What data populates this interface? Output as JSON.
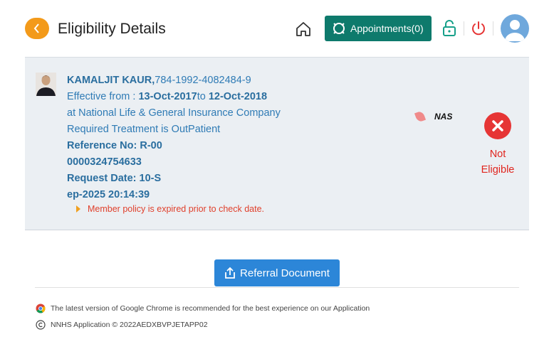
{
  "header": {
    "title": "Eligibility Details",
    "appointments_label": "Appointments",
    "appointments_count": "(0)"
  },
  "patient": {
    "name": "KAMALJIT KAUR,",
    "id": "784-1992-4082484-9",
    "effective_prefix": "Effective from : ",
    "effective_from": "13-Oct-2017",
    "to_word": "to",
    "effective_to": "12-Oct-2018",
    "insurer_line": "at National Life & General Insurance Company",
    "treatment_line": "Required Treatment is OutPatient",
    "reference_label": "Reference No: ",
    "reference_no": "R-000000324754633",
    "request_label": "Request Date: ",
    "request_date": "10-Sep-2025 20:14:39",
    "warning": "Member policy is expired prior to check date."
  },
  "provider_tag": "NAS",
  "status": {
    "line1": "Not",
    "line2": "Eligible",
    "color": "#e63535"
  },
  "referral_button": "Referral Document",
  "footer": {
    "browser_note": "The latest version of Google Chrome is recommended for the best experience on our Application",
    "copyright": "NNHS Application © 2022AEDXBVPJETAPP02"
  },
  "colors": {
    "accent_orange": "#f39a1a",
    "appointments_bg": "#0e7a6c",
    "link_blue": "#2f7bb5",
    "button_blue": "#2c86d8"
  }
}
